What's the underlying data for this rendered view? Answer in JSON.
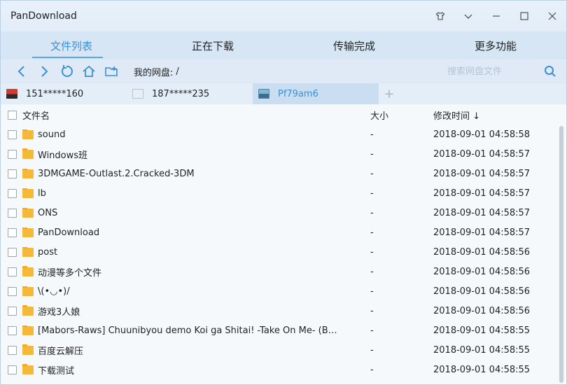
{
  "window": {
    "title": "PanDownload"
  },
  "tabs": [
    {
      "label": "文件列表"
    },
    {
      "label": "正在下载"
    },
    {
      "label": "传输完成"
    },
    {
      "label": "更多功能"
    }
  ],
  "toolbar": {
    "path_label": "我的网盘:",
    "path_value": "/",
    "search_placeholder": "搜索网盘文件"
  },
  "accounts": [
    {
      "name": "151*****160",
      "icon": "flag-avatar"
    },
    {
      "name": "187*****235",
      "icon": "blank-avatar"
    },
    {
      "name": "Pf79am6",
      "icon": "photo-avatar"
    }
  ],
  "list": {
    "headers": {
      "name": "文件名",
      "size": "大小",
      "time": "修改时间 ↓"
    },
    "rows": [
      {
        "name": "sound",
        "size": "-",
        "time": "2018-09-01 04:58:58"
      },
      {
        "name": "Windows班",
        "size": "-",
        "time": "2018-09-01 04:58:57"
      },
      {
        "name": "3DMGAME-Outlast.2.Cracked-3DM",
        "size": "-",
        "time": "2018-09-01 04:58:57"
      },
      {
        "name": "lb",
        "size": "-",
        "time": "2018-09-01 04:58:57"
      },
      {
        "name": "ONS",
        "size": "-",
        "time": "2018-09-01 04:58:57"
      },
      {
        "name": "PanDownload",
        "size": "-",
        "time": "2018-09-01 04:58:57"
      },
      {
        "name": "post",
        "size": "-",
        "time": "2018-09-01 04:58:56"
      },
      {
        "name": "动漫等多个文件",
        "size": "-",
        "time": "2018-09-01 04:58:56"
      },
      {
        "name": "\\(•◡•)/",
        "size": "-",
        "time": "2018-09-01 04:58:56"
      },
      {
        "name": "游戏3人娘",
        "size": "-",
        "time": "2018-09-01 04:58:56"
      },
      {
        "name": "[Mabors-Raws] Chuunibyou demo Koi ga Shitai! -Take On Me- (BDrip ...",
        "size": "-",
        "time": "2018-09-01 04:58:55"
      },
      {
        "name": "百度云解压",
        "size": "-",
        "time": "2018-09-01 04:58:55"
      },
      {
        "name": "下载测试",
        "size": "-",
        "time": "2018-09-01 04:58:55"
      }
    ]
  }
}
